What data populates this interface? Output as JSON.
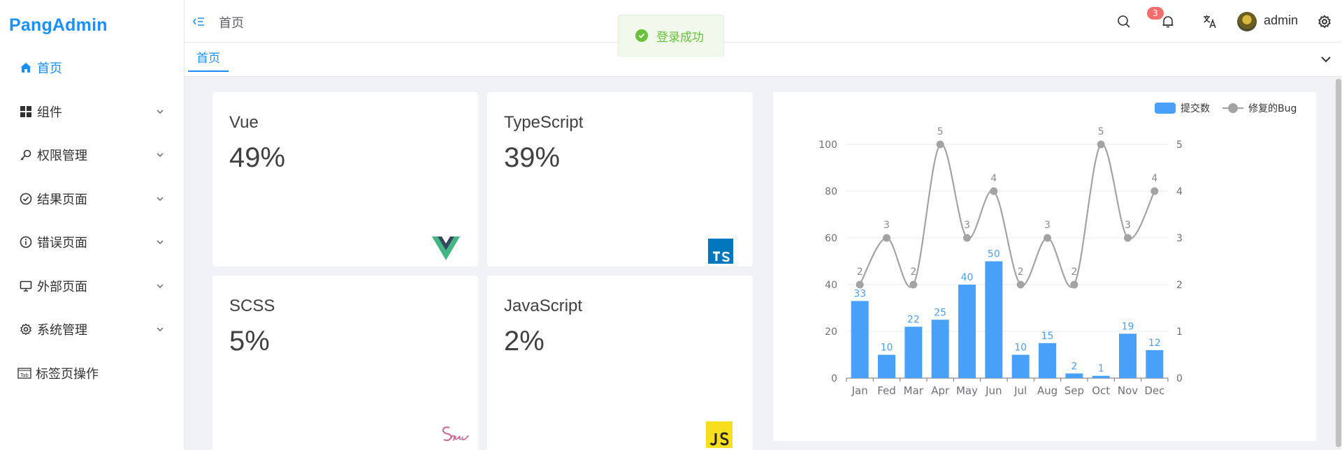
{
  "app": {
    "logo": "PangAdmin"
  },
  "sidebar": {
    "items": [
      {
        "label": "首页",
        "icon": "home-icon",
        "active": true,
        "expandable": false
      },
      {
        "label": "组件",
        "icon": "grid-icon",
        "active": false,
        "expandable": true
      },
      {
        "label": "权限管理",
        "icon": "key-icon",
        "active": false,
        "expandable": true
      },
      {
        "label": "结果页面",
        "icon": "check-circle-icon",
        "active": false,
        "expandable": true
      },
      {
        "label": "错误页面",
        "icon": "info-circle-icon",
        "active": false,
        "expandable": true
      },
      {
        "label": "外部页面",
        "icon": "monitor-icon",
        "active": false,
        "expandable": true
      },
      {
        "label": "系统管理",
        "icon": "gear-icon",
        "active": false,
        "expandable": true
      },
      {
        "label": "标签页操作",
        "icon": "tab-icon",
        "active": false,
        "expandable": false
      }
    ]
  },
  "header": {
    "breadcrumb": "首页",
    "notification_count": "3",
    "username": "admin"
  },
  "toast": {
    "message": "登录成功",
    "type": "success"
  },
  "tags": [
    {
      "label": "首页",
      "active": true
    }
  ],
  "cards": [
    {
      "title": "Vue",
      "value": "49%",
      "logo": "vue-logo"
    },
    {
      "title": "TypeScript",
      "value": "39%",
      "logo": "typescript-logo"
    },
    {
      "title": "SCSS",
      "value": "5%",
      "logo": "sass-logo"
    },
    {
      "title": "JavaScript",
      "value": "2%",
      "logo": "javascript-logo"
    }
  ],
  "colors": {
    "primary": "#1890ff",
    "bar": "#48a0f8",
    "line": "#a3a3a3",
    "success": "#67c23a",
    "danger": "#f56c6c"
  },
  "chart_data": {
    "type": "bar",
    "categories": [
      "Jan",
      "Fed",
      "Mar",
      "Apr",
      "May",
      "Jun",
      "Jul",
      "Aug",
      "Sep",
      "Oct",
      "Nov",
      "Dec"
    ],
    "series": [
      {
        "name": "提交数",
        "type": "bar",
        "axis": "left",
        "values": [
          33,
          10,
          22,
          25,
          40,
          50,
          10,
          15,
          2,
          1,
          19,
          12
        ]
      },
      {
        "name": "修复的Bug",
        "type": "line",
        "smooth": true,
        "axis": "right",
        "values": [
          2,
          3,
          2,
          5,
          3,
          4,
          2,
          3,
          2,
          5,
          3,
          4
        ]
      }
    ],
    "ylim": [
      0,
      100
    ],
    "yticks": [
      0,
      20,
      40,
      60,
      80,
      100
    ],
    "y2lim": [
      0,
      5
    ],
    "y2ticks": [
      0,
      1,
      2,
      3,
      4,
      5
    ],
    "grid": true,
    "legend": "top-right"
  }
}
